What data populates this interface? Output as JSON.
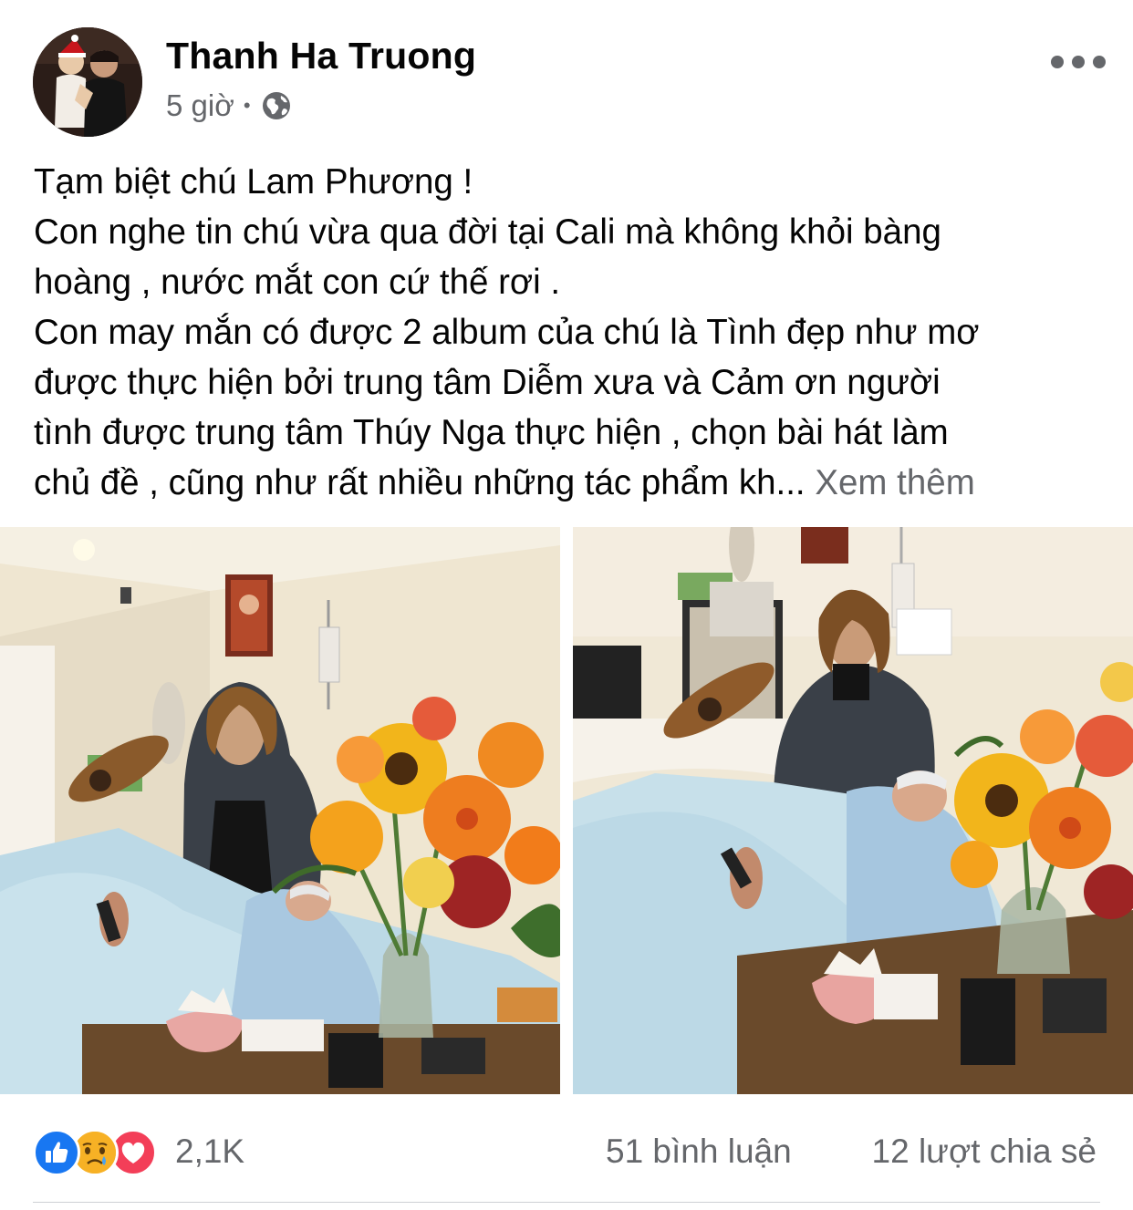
{
  "post": {
    "author": "Thanh Ha Truong",
    "time": "5 giờ",
    "separator": "•",
    "privacy_icon": "globe-icon",
    "text_lines": [
      "Tạm biệt chú Lam Phương !",
      "Con nghe tin chú vừa qua đời tại Cali mà không khỏi bàng",
      "hoàng , nước mắt con cứ thế rơi .",
      "Con may mắn có được 2 album của chú là Tình đẹp như mơ",
      "được thực hiện bởi trung tâm Diễm xưa và Cảm ơn người",
      "tình được trung tâm Thúy Nga thực hiện , chọn bài hát làm"
    ],
    "last_line": "chủ đề , cũng như rất nhiều những tác phẩm kh...",
    "see_more": "Xem thêm"
  },
  "footer": {
    "reactions": [
      "like-icon",
      "sad-icon",
      "love-icon"
    ],
    "reaction_count": "2,1K",
    "comments": "51 bình luận",
    "shares": "12 lượt chia sẻ"
  },
  "colors": {
    "text": "#050505",
    "secondary": "#65676b",
    "like": "#1877f2",
    "love": "#f33e58",
    "sad": "#f7b125"
  }
}
